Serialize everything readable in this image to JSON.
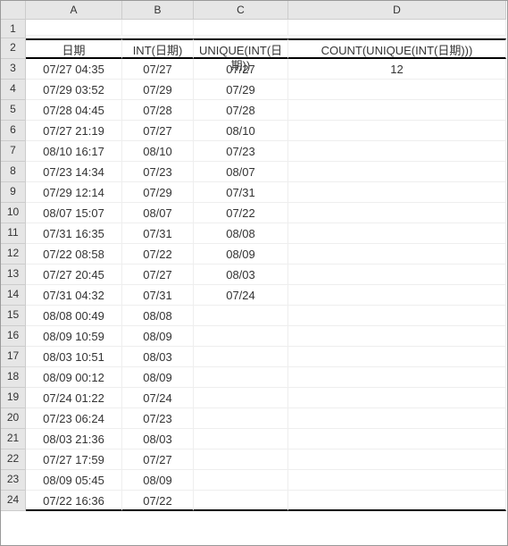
{
  "colHeaders": [
    "A",
    "B",
    "C",
    "D"
  ],
  "headers": {
    "a": "日期",
    "b": "INT(日期)",
    "c": "UNIQUE(INT(日期))",
    "d": "COUNT(UNIQUE(INT(日期)))"
  },
  "result_d3": "12",
  "rows": [
    {
      "r": "3",
      "a": "07/27 04:35",
      "b": "07/27",
      "c": "07/27"
    },
    {
      "r": "4",
      "a": "07/29 03:52",
      "b": "07/29",
      "c": "07/29"
    },
    {
      "r": "5",
      "a": "07/28 04:45",
      "b": "07/28",
      "c": "07/28"
    },
    {
      "r": "6",
      "a": "07/27 21:19",
      "b": "07/27",
      "c": "08/10"
    },
    {
      "r": "7",
      "a": "08/10 16:17",
      "b": "08/10",
      "c": "07/23"
    },
    {
      "r": "8",
      "a": "07/23 14:34",
      "b": "07/23",
      "c": "08/07"
    },
    {
      "r": "9",
      "a": "07/29 12:14",
      "b": "07/29",
      "c": "07/31"
    },
    {
      "r": "10",
      "a": "08/07 15:07",
      "b": "08/07",
      "c": "07/22"
    },
    {
      "r": "11",
      "a": "07/31 16:35",
      "b": "07/31",
      "c": "08/08"
    },
    {
      "r": "12",
      "a": "07/22 08:58",
      "b": "07/22",
      "c": "08/09"
    },
    {
      "r": "13",
      "a": "07/27 20:45",
      "b": "07/27",
      "c": "08/03"
    },
    {
      "r": "14",
      "a": "07/31 04:32",
      "b": "07/31",
      "c": "07/24"
    },
    {
      "r": "15",
      "a": "08/08 00:49",
      "b": "08/08",
      "c": ""
    },
    {
      "r": "16",
      "a": "08/09 10:59",
      "b": "08/09",
      "c": ""
    },
    {
      "r": "17",
      "a": "08/03 10:51",
      "b": "08/03",
      "c": ""
    },
    {
      "r": "18",
      "a": "08/09 00:12",
      "b": "08/09",
      "c": ""
    },
    {
      "r": "19",
      "a": "07/24 01:22",
      "b": "07/24",
      "c": ""
    },
    {
      "r": "20",
      "a": "07/23 06:24",
      "b": "07/23",
      "c": ""
    },
    {
      "r": "21",
      "a": "08/03 21:36",
      "b": "08/03",
      "c": ""
    },
    {
      "r": "22",
      "a": "07/27 17:59",
      "b": "07/27",
      "c": ""
    },
    {
      "r": "23",
      "a": "08/09 05:45",
      "b": "08/09",
      "c": ""
    },
    {
      "r": "24",
      "a": "07/22 16:36",
      "b": "07/22",
      "c": ""
    }
  ]
}
